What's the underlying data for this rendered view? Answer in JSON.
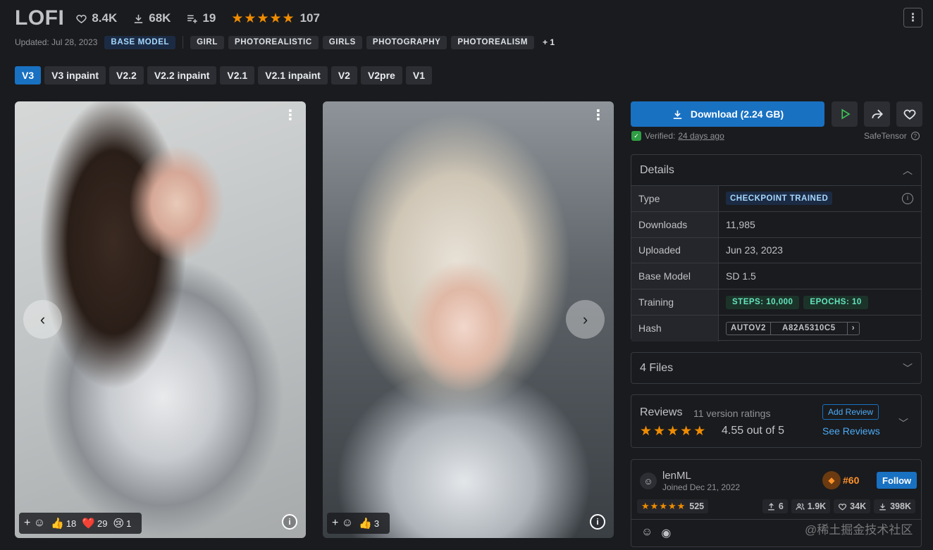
{
  "model": {
    "title": "LOFI",
    "likes": "8.4K",
    "downloads_count": "68K",
    "collections": "19",
    "rating_count": "107",
    "stars": 5
  },
  "meta": {
    "updated": "Updated: Jul 28, 2023",
    "base_tag": "BASE MODEL",
    "tags": [
      "GIRL",
      "PHOTOREALISTIC",
      "GIRLS",
      "PHOTOGRAPHY",
      "PHOTOREALISM"
    ],
    "more_tags": "+ 1"
  },
  "versions": [
    "V3",
    "V3 inpaint",
    "V2.2",
    "V2.2 inpaint",
    "V2.1",
    "V2.1 inpaint",
    "V2",
    "V2pre",
    "V1"
  ],
  "active_version": "V3",
  "images": [
    {
      "reactions": [
        {
          "icon": "thumbs-up-icon",
          "emoji": "👍",
          "count": "18"
        },
        {
          "icon": "heart-icon",
          "emoji": "❤️",
          "count": "29"
        },
        {
          "icon": "sad-face-icon",
          "emoji": "😢",
          "count": "1"
        }
      ]
    },
    {
      "reactions": [
        {
          "icon": "thumbs-up-icon",
          "emoji": "👍",
          "count": "3"
        }
      ]
    }
  ],
  "download": {
    "label": "Download (2.24 GB)",
    "verified_label": "Verified:",
    "verified_when": "24 days ago",
    "format": "SafeTensor"
  },
  "details": {
    "header": "Details",
    "type_label": "Type",
    "type_value": "CHECKPOINT TRAINED",
    "downloads_label": "Downloads",
    "downloads_value": "11,985",
    "uploaded_label": "Uploaded",
    "uploaded_value": "Jun 23, 2023",
    "base_model_label": "Base Model",
    "base_model_value": "SD 1.5",
    "training_label": "Training",
    "steps": "STEPS: 10,000",
    "epochs": "EPOCHS: 10",
    "hash_label": "Hash",
    "hash_type": "AUTOV2",
    "hash_value": "A82A5310C5"
  },
  "files": {
    "label": "4 Files"
  },
  "reviews": {
    "title": "Reviews",
    "count": "11 version ratings",
    "score": "4.55 out of 5",
    "add": "Add Review",
    "see": "See Reviews",
    "stars": 5
  },
  "creator": {
    "name": "lenML",
    "joined": "Joined Dec 21, 2022",
    "rank": "#60",
    "follow": "Follow",
    "rating_count": "525",
    "uploads": "6",
    "followers": "1.9K",
    "favorites": "34K",
    "downloads": "398K"
  },
  "watermark": "@稀土掘金技术社区",
  "colors": {
    "accent": "#1971c2",
    "star": "#f08c00",
    "background": "#1a1b1e"
  }
}
